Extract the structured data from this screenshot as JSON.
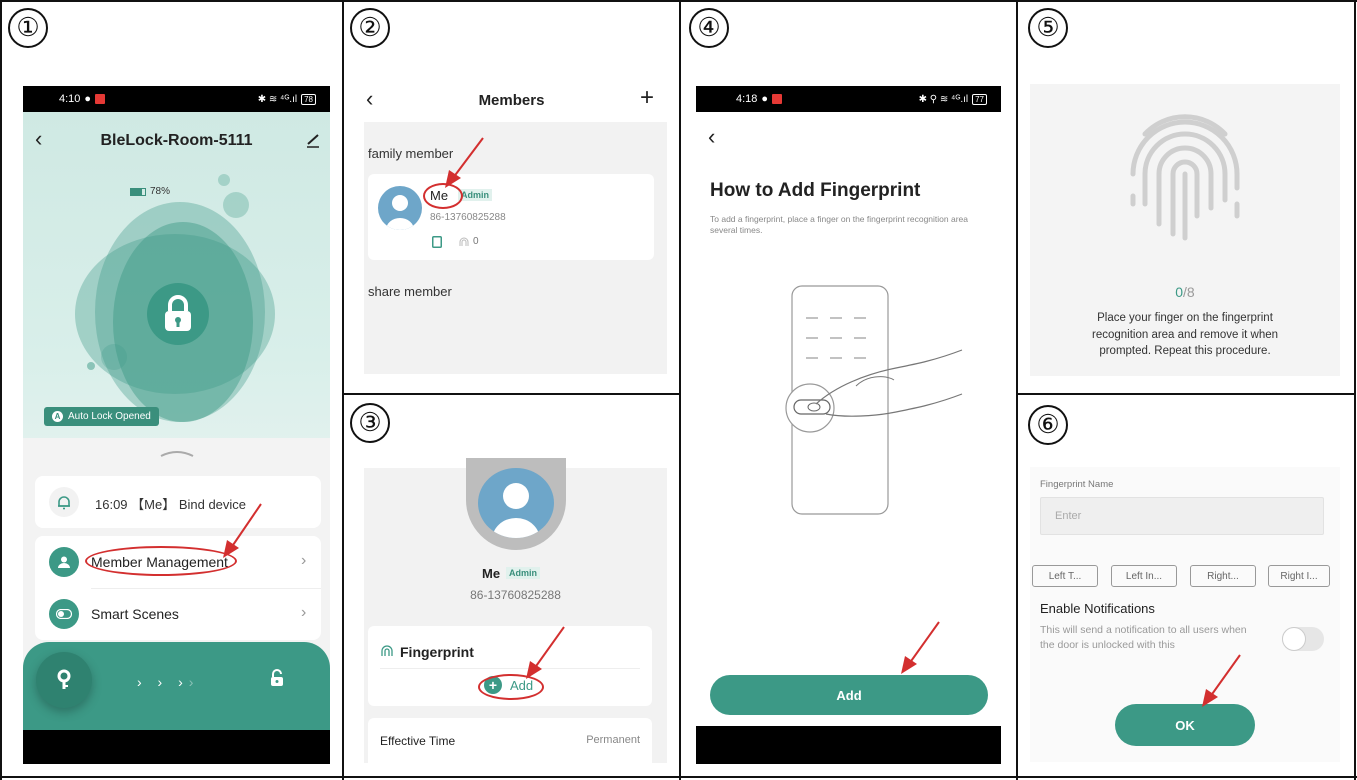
{
  "steps": [
    "①",
    "②",
    "③",
    "④",
    "⑤",
    "⑥"
  ],
  "colors": {
    "accent": "#3c9986",
    "annotation": "#d32f2f",
    "admin_tag": "#3a8f7c"
  },
  "panel1": {
    "status_time": "4:10",
    "status_right": "✱ ≋ ⁴ᴳ.ıl",
    "battery_badge": "78",
    "title": "BleLock-Room-5111",
    "battery": "78%",
    "auto_lock": "Auto Lock Opened",
    "auto_lock_icon": "A",
    "notice": "16:09 【Me】 Bind device",
    "menu": [
      {
        "label": "Member Management",
        "icon": "user-icon"
      },
      {
        "label": "Smart Scenes",
        "icon": "toggle-icon"
      }
    ],
    "slider_arrows": "› › ›",
    "slider_arrow_faded": "›"
  },
  "panel2": {
    "title": "Members",
    "section_family": "family member",
    "member_name": "Me",
    "member_role": "Admin",
    "member_phone": "86-13760825288",
    "fingerprint_count": "0",
    "section_share": "share member"
  },
  "panel3": {
    "name": "Me",
    "role": "Admin",
    "phone": "86-13760825288",
    "section": "Fingerprint",
    "add_label": "Add",
    "effective_label": "Effective Time",
    "effective_value": "Permanent"
  },
  "panel4": {
    "status_time": "4:18",
    "status_right": "✱ ⚲ ≋ ⁴ᴳ.ıl",
    "battery_badge": "77",
    "title": "How to Add Fingerprint",
    "description": "To add a fingerprint, place a finger on the fingerprint recognition area several times.",
    "add_button": "Add"
  },
  "panel5": {
    "progress_current": "0",
    "progress_total": "/8",
    "instruction": "Place your finger on the fingerprint recognition area and remove it when prompted. Repeat this procedure."
  },
  "panel6": {
    "name_label": "Fingerprint Name",
    "placeholder": "Enter",
    "chips": [
      "Left T...",
      "Left In...",
      "Right...",
      "Right I..."
    ],
    "notif_title": "Enable Notifications",
    "notif_desc": "This will send a notification to all users when the door is unlocked with this",
    "ok_button": "OK"
  }
}
